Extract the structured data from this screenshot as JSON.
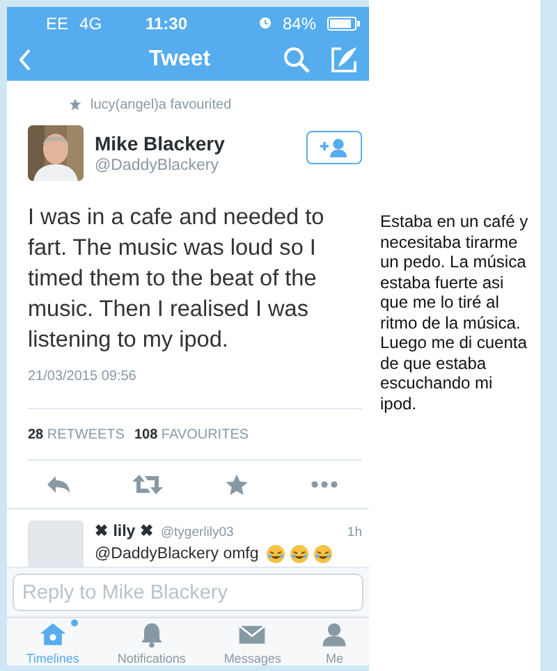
{
  "status_bar": {
    "carrier": "EE",
    "network": "4G",
    "time": "11:30",
    "battery": "84%"
  },
  "nav": {
    "title": "Tweet"
  },
  "tweet": {
    "social_context": "lucy(angel)a favourited",
    "author_name": "Mike Blackery",
    "author_handle": "@DaddyBlackery",
    "text": "I was in a cafe and needed to fart. The music was loud so I timed them to the beat of the music. Then I realised I was listening to my ipod.",
    "timestamp": "21/03/2015 09:56",
    "retweets_count": "28",
    "retweets_label": "RETWEETS",
    "favourites_count": "108",
    "favourites_label": "FAVOURITES"
  },
  "reply": {
    "name": "✖ lily ✖",
    "handle": "@tygerlily03",
    "time": "1h",
    "text": "@DaddyBlackery omfg"
  },
  "reply_field": {
    "placeholder": "Reply to Mike Blackery"
  },
  "tabs": [
    {
      "label": "Timelines",
      "selected": true,
      "unread": true
    },
    {
      "label": "Notifications",
      "selected": false,
      "unread": false
    },
    {
      "label": "Messages",
      "selected": false,
      "unread": false
    },
    {
      "label": "Me",
      "selected": false,
      "unread": false
    }
  ],
  "translation": "Estaba en un café y necesitaba tirarme un pedo. La música estaba fuerte asi que me lo tiré al ritmo de la música. Luego me di cuenta de que estaba escuchando mi ipod."
}
